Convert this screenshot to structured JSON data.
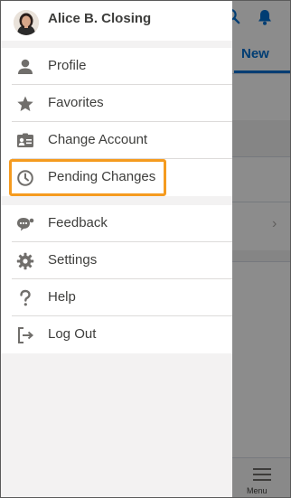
{
  "user": {
    "name": "Alice B. Closing"
  },
  "background": {
    "tab_label": "New",
    "footer_menu_label": "Menu"
  },
  "menu": {
    "group1": [
      {
        "label": "Profile",
        "icon": "user-icon"
      },
      {
        "label": "Favorites",
        "icon": "star-icon"
      },
      {
        "label": "Change Account",
        "icon": "contact-card-icon"
      },
      {
        "label": "Pending Changes",
        "icon": "clock-icon"
      }
    ],
    "group2": [
      {
        "label": "Feedback",
        "icon": "feedback-icon"
      },
      {
        "label": "Settings",
        "icon": "gear-icon"
      },
      {
        "label": "Help",
        "icon": "question-icon"
      },
      {
        "label": "Log Out",
        "icon": "logout-icon"
      }
    ]
  },
  "colors": {
    "highlight": "#f59b1f",
    "brand": "#0070d2",
    "icon": "#706e6b",
    "text": "#3e3e3c"
  }
}
